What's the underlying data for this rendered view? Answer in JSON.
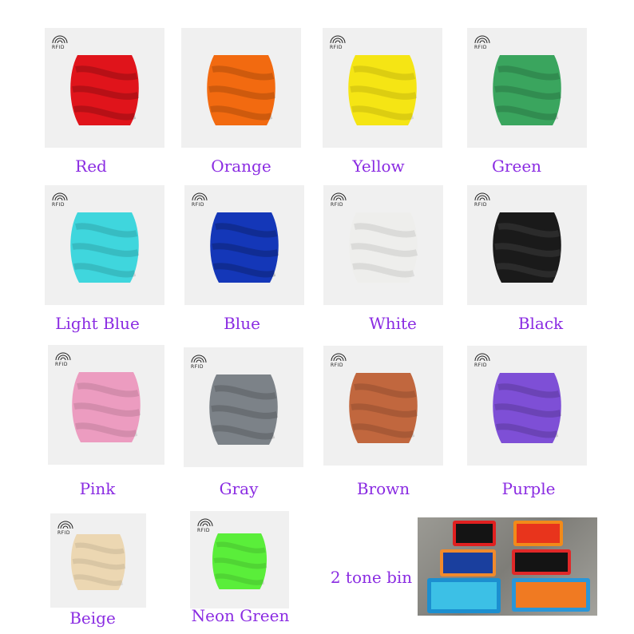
{
  "swatches": [
    {
      "label": "Red",
      "color": "#e0141b"
    },
    {
      "label": "Orange",
      "color": "#f26a10"
    },
    {
      "label": "Yellow",
      "color": "#f5e514"
    },
    {
      "label": "Green",
      "color": "#3aa55e"
    },
    {
      "label": "Light Blue",
      "color": "#3fd6dd"
    },
    {
      "label": "Blue",
      "color": "#1437b8"
    },
    {
      "label": "White",
      "color": "#eeeeec"
    },
    {
      "label": "Black",
      "color": "#1a1a1a"
    },
    {
      "label": "Pink",
      "color": "#ec9cc0"
    },
    {
      "label": "Gray",
      "color": "#7c8288"
    },
    {
      "label": "Brown",
      "color": "#c1673e"
    },
    {
      "label": "Purple",
      "color": "#7e4fd6"
    },
    {
      "label": "Beige",
      "color": "#ecd7b2"
    },
    {
      "label": "Neon Green",
      "color": "#5aee3a"
    }
  ],
  "rfid_text": "RFID",
  "bin_label": "2 tone bin",
  "label_color": "#8a2be2"
}
